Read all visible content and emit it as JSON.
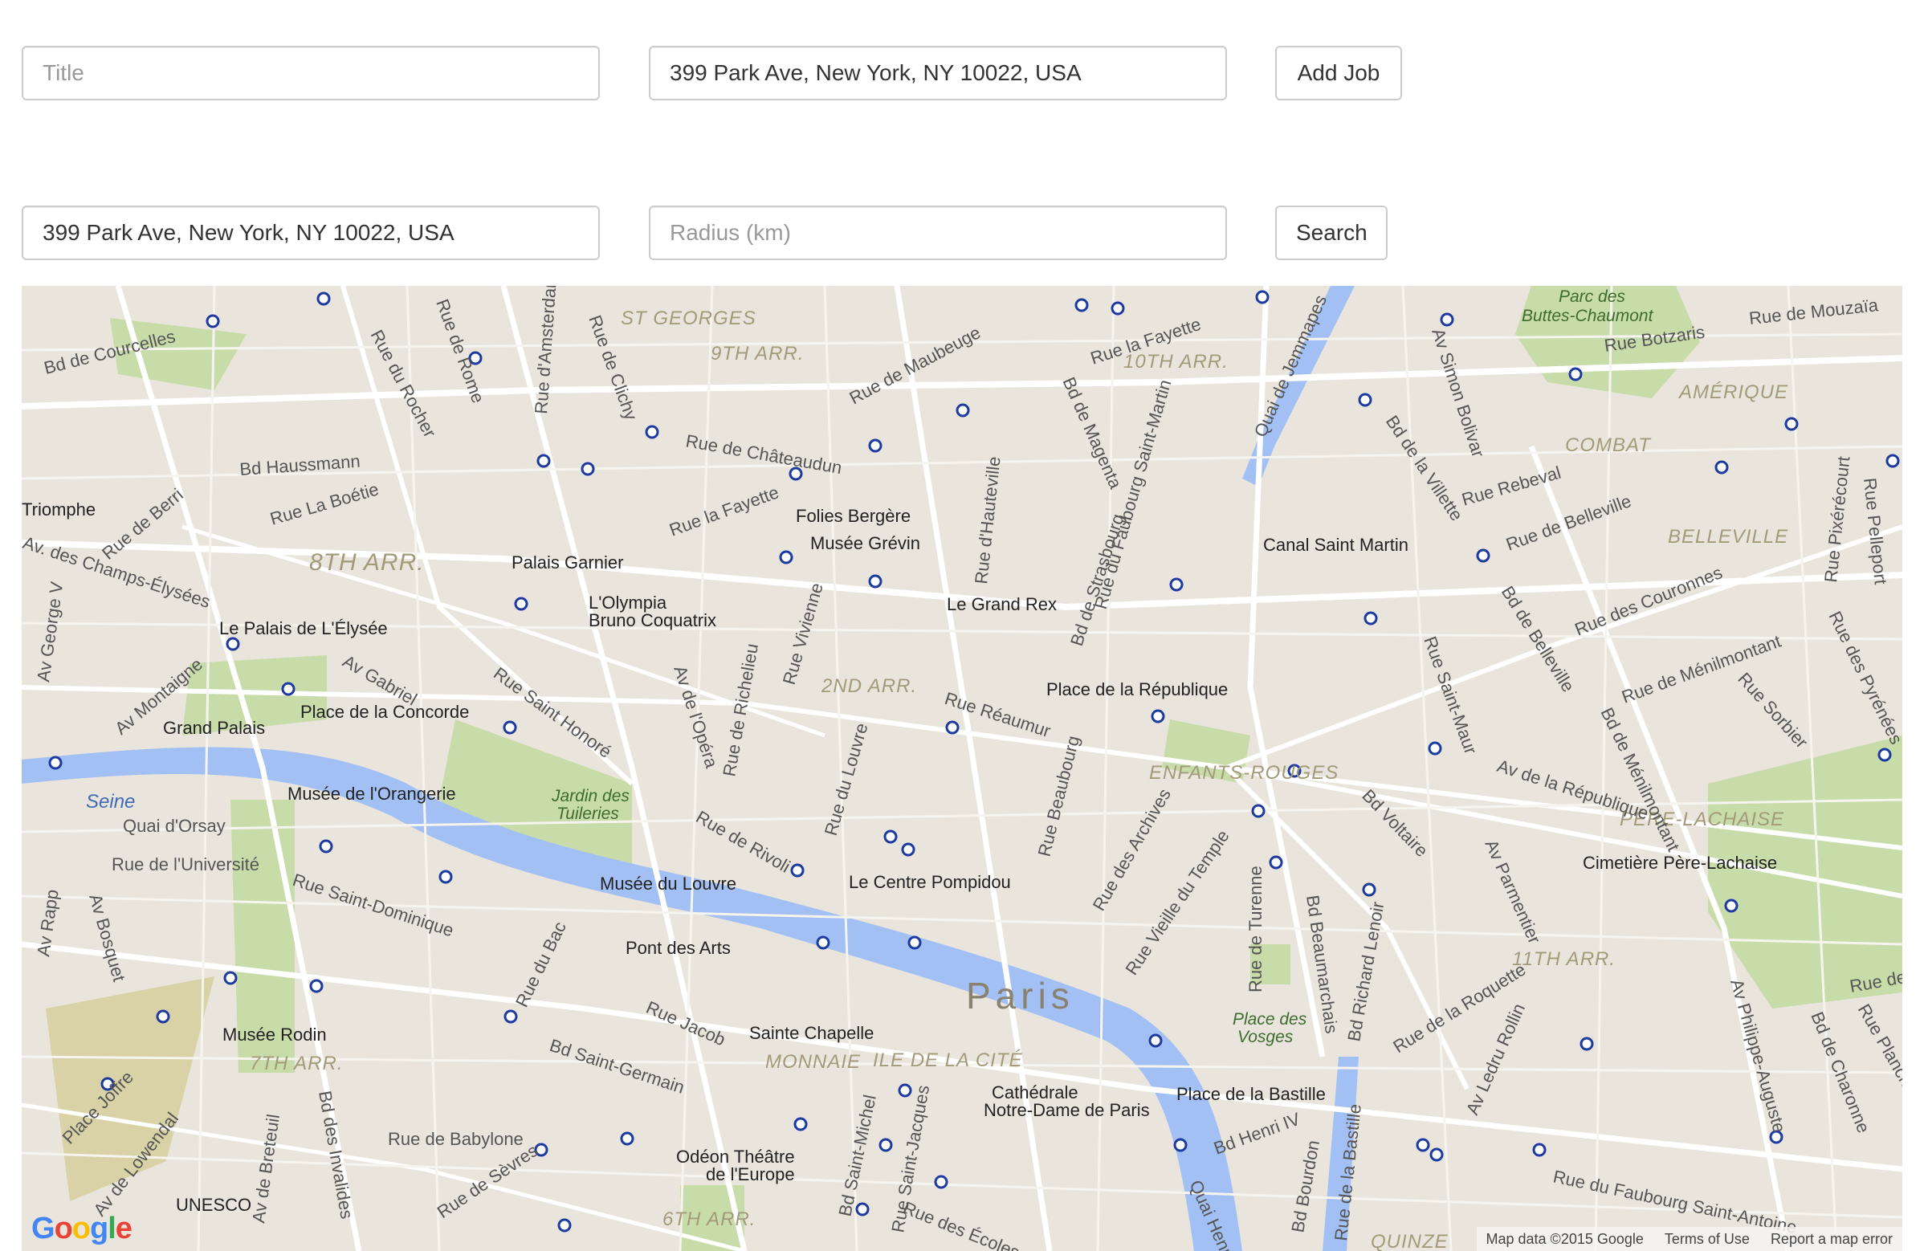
{
  "job_form": {
    "title_placeholder": "Title",
    "address_value": "399 Park Ave, New York, NY 10022, USA",
    "add_label": "Add Job"
  },
  "search_form": {
    "address_value": "399 Park Ave, New York, NY 10022, USA",
    "radius_placeholder": "Radius (km)",
    "search_label": "Search"
  },
  "map": {
    "city_label": "Paris",
    "districts": [
      "ST GEORGES",
      "9TH ARR.",
      "10TH ARR.",
      "8TH ARR.",
      "2ND ARR.",
      "ENFANTS-ROUGES",
      "AMÉRIQUE",
      "COMBAT",
      "BELLEVILLE",
      "PÈRE-LACHAISE",
      "11TH ARR.",
      "7TH ARR.",
      "6TH ARR.",
      "MONNAIE",
      "ILE DE LA CITÉ",
      "QUINZE"
    ],
    "places": [
      "Parc des",
      "Buttes-Chaumont",
      "Folies Bergère",
      "Musée Grévin",
      "Palais Garnier",
      "L'Olympia",
      "Bruno Coquatrix",
      "Le Grand Rex",
      "Canal Saint Martin",
      "Le Palais de L'Élysée",
      "Place de la République",
      "Grand Palais",
      "Place de la Concorde",
      "Musée de l'Orangerie",
      "Jardin des",
      "Tuileries",
      "Musée du Louvre",
      "Le Centre Pompidou",
      "Cimetière Père-Lachaise",
      "Pont des Arts",
      "Musée Rodin",
      "Sainte Chapelle",
      "Cathédrale",
      "Notre-Dame de Paris",
      "Place de la Bastille",
      "Place des",
      "Vosges",
      "Odéon Théâtre",
      "de l'Europe",
      "UNESCO",
      "Seine",
      "Triomphe"
    ],
    "streets": [
      "Bd de Courcelles",
      "Rue de Rome",
      "Rue d'Amsterdam",
      "Rue de Clichy",
      "Rue du Rocher",
      "Rue de Maubeuge",
      "Rue la Fayette",
      "Rue de Châteaudun",
      "Bd Haussmann",
      "Rue La Boétie",
      "Rue de Berri",
      "Rue la Fayette",
      "Av. des Champs-Élysées",
      "Av George V",
      "Av Montaigne",
      "Av Gabriel",
      "Rue Saint Honoré",
      "Av de l'Opéra",
      "Rue de Richelieu",
      "Rue Vivienne",
      "Rue Réaumur",
      "Rue du Louvre",
      "Rue de Rivoli",
      "Bd de Magenta",
      "Bd de Strasbourg",
      "Rue du Faubourg Saint-Martin",
      "Rue d'Hauteville",
      "Quai de Jemmapes",
      "Av Simon Bolivar",
      "Bd de la Villette",
      "Rue Botzaris",
      "Rue de Mouzaïa",
      "Rue Rebeval",
      "Rue de Belleville",
      "Bd de Belleville",
      "Rue des Couronnes",
      "Rue de Ménilmontant",
      "Rue des Pyrénées",
      "Rue Sorbier",
      "Av de la République",
      "Bd de Ménilmontant",
      "Rue Saint-Maur",
      "Bd Voltaire",
      "Av Parmentier",
      "Rue Beaubourg",
      "Rue des Archives",
      "Rue Vieille du Temple",
      "Rue de Turenne",
      "Bd Beaumarchais",
      "Bd Richard Lenoir",
      "Rue de la Roquette",
      "Av Ledru Rollin",
      "Bd Henri IV",
      "Rue du Faubourg Saint-Antoine",
      "Av Philippe-Auguste",
      "Bd de Charonne",
      "Rue Planchat",
      "Quai d'Orsay",
      "Rue de l'Université",
      "Rue Saint-Dominique",
      "Av Rapp",
      "Av Bosquet",
      "Bd Saint-Germain",
      "Rue Jacob",
      "Rue du Bac",
      "Rue de Babylone",
      "Bd des Invalides",
      "Av de Breteuil",
      "Place Joffre",
      "Av de Lowendal",
      "Rue de Sèvres",
      "Bd Saint-Michel",
      "Rue Saint-Jacques",
      "Rue des Écoles",
      "Bd Bourdon",
      "Rue de la Bastille",
      "Quai Henri IV",
      "Rue Pelleport",
      "Rue Pixérécourt",
      "Rue de"
    ],
    "logo_letters": [
      "G",
      "o",
      "o",
      "g",
      "l",
      "e"
    ],
    "attribution": [
      "Map data ©2015 Google",
      "Terms of Use",
      "Report a map error"
    ]
  }
}
